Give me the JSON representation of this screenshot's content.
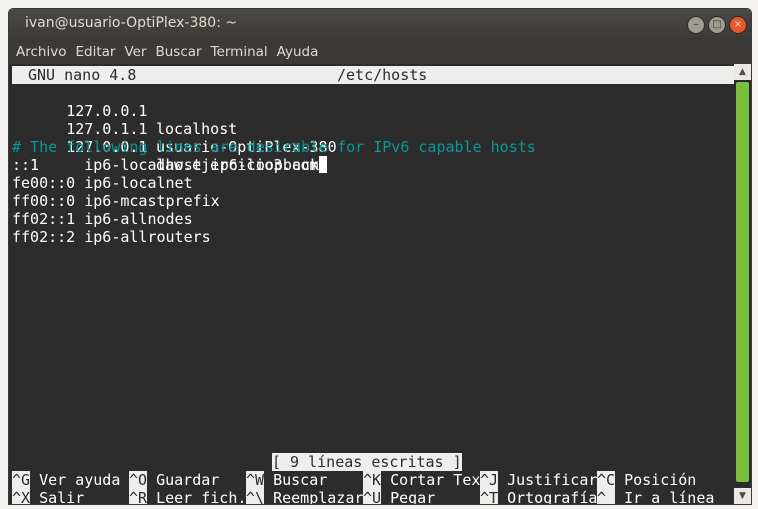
{
  "window": {
    "title": "ivan@usuario-OptiPlex-380: ~",
    "buttons": {
      "minimize": "–",
      "maximize": "□",
      "close": "×"
    }
  },
  "menubar": [
    "Archivo",
    "Editar",
    "Ver",
    "Buscar",
    "Terminal",
    "Ayuda"
  ],
  "nano": {
    "version": "GNU nano 4.8",
    "filename": "/etc/hosts",
    "lines": [
      {
        "ip": "127.0.0.1",
        "name": "localhost"
      },
      {
        "ip": "127.0.1.1",
        "name": "usuario-OptiPlex-380"
      },
      {
        "ip": "127.0.0.1",
        "name": "daw.ejercicio3.com"
      }
    ],
    "comment": "# The following lines are desirable for IPv6 capable hosts",
    "ipv6_lines": [
      "::1     ip6-localhost ip6-loopback",
      "fe00::0 ip6-localnet",
      "ff00::0 ip6-mcastprefix",
      "ff02::1 ip6-allnodes",
      "ff02::2 ip6-allrouters"
    ],
    "status": "[ 9 líneas escritas ]",
    "shortcuts_row1": [
      {
        "key": "^G",
        "label": "Ver ayuda"
      },
      {
        "key": "^O",
        "label": "Guardar"
      },
      {
        "key": "^W",
        "label": "Buscar"
      },
      {
        "key": "^K",
        "label": "Cortar Tex"
      },
      {
        "key": "^J",
        "label": "Justificar"
      },
      {
        "key": "^C",
        "label": "Posición"
      }
    ],
    "shortcuts_row2": [
      {
        "key": "^X",
        "label": "Salir"
      },
      {
        "key": "^R",
        "label": "Leer fich."
      },
      {
        "key": "^\\",
        "label": "Reemplazar"
      },
      {
        "key": "^U",
        "label": "Pegar"
      },
      {
        "key": "^T",
        "label": "Ortografía"
      },
      {
        "key": "^_",
        "label": "Ir a línea"
      }
    ]
  },
  "colors": {
    "background": "#2c2c2c",
    "text": "#ffffff",
    "comment": "#06989a",
    "scrollbar_thumb": "#7abe3c",
    "titlebar": "#3b3a36",
    "close_button": "#e9572d"
  }
}
